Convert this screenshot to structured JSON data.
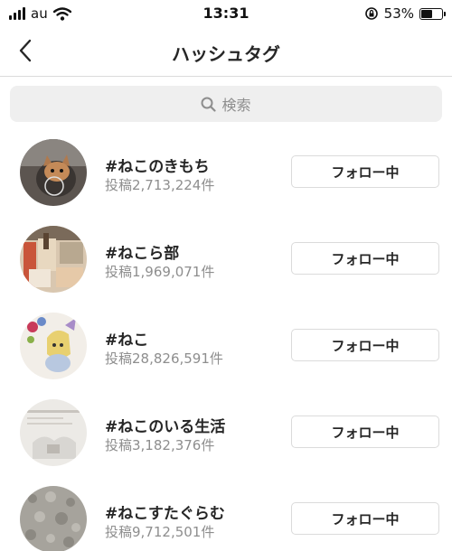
{
  "status_bar": {
    "carrier": "au",
    "time": "13:31",
    "battery_percent": "53%",
    "battery_level": 0.53
  },
  "nav": {
    "title": "ハッシュタグ",
    "back_icon": "chevron-left-icon"
  },
  "search": {
    "placeholder": "検索",
    "icon": "search-icon"
  },
  "hashtags": [
    {
      "name": "#ねこのきもち",
      "count": "投稿2,713,224件",
      "button": "フォロー中"
    },
    {
      "name": "#ねこら部",
      "count": "投稿1,969,071件",
      "button": "フォロー中"
    },
    {
      "name": "#ねこ",
      "count": "投稿28,826,591件",
      "button": "フォロー中"
    },
    {
      "name": "#ねこのいる生活",
      "count": "投稿3,182,376件",
      "button": "フォロー中"
    },
    {
      "name": "#ねこすたぐらむ",
      "count": "投稿9,712,501件",
      "button": "フォロー中"
    }
  ],
  "colors": {
    "text_primary": "#262626",
    "text_secondary": "#8e8e8e",
    "border": "#dbdbdb",
    "search_bg": "#efefef"
  }
}
